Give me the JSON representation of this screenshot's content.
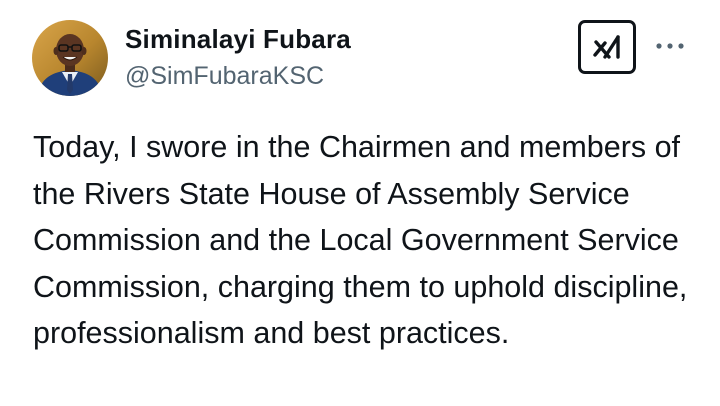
{
  "author": {
    "display_name": "Siminalayi Fubara",
    "handle": "@SimFubaraKSC"
  },
  "actions": {
    "grok_icon": "grok-icon",
    "more_icon": "more-horizontal-icon"
  },
  "tweet": {
    "text": "Today, I swore in the Chairmen and members of the Rivers State House of Assembly Service Commission and the Local Government Service Commission, charging them to uphold discipline, professionalism and best practices."
  },
  "colors": {
    "text_primary": "#0f1419",
    "text_secondary": "#536471",
    "background": "#ffffff"
  }
}
